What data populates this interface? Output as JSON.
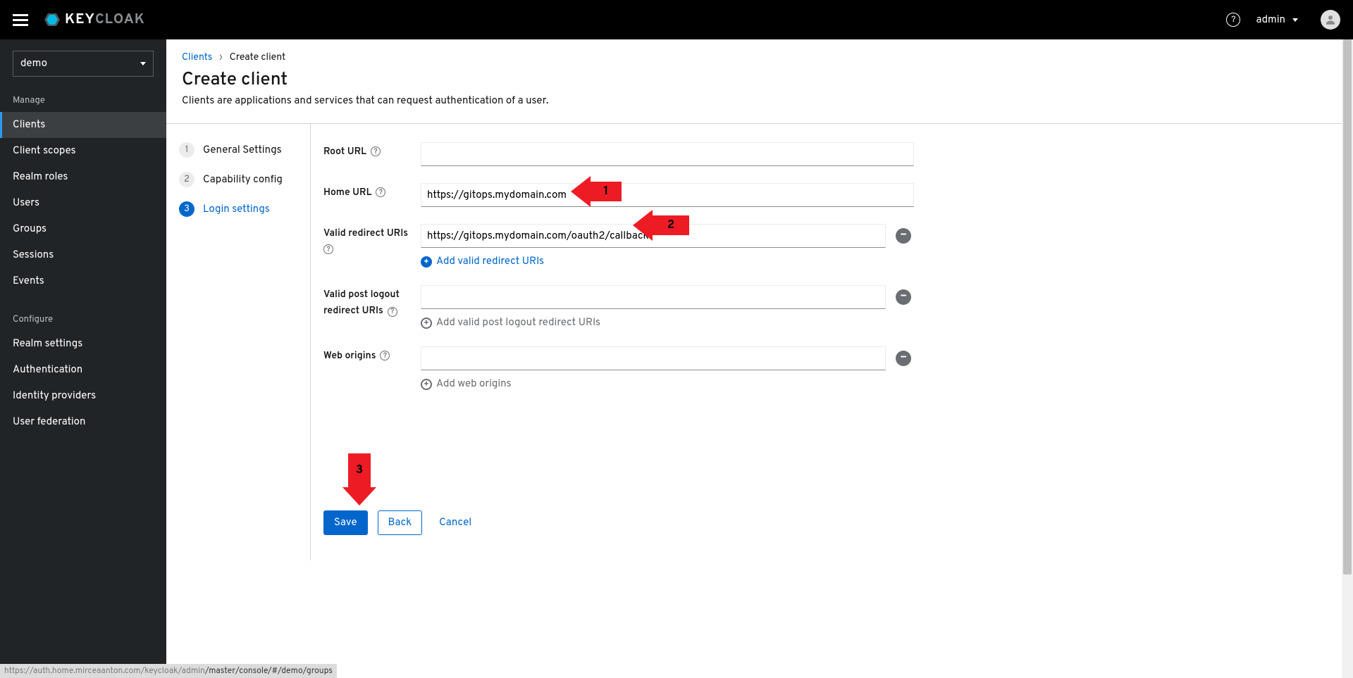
{
  "header": {
    "brand_prefix": "KEY",
    "brand_suffix": "CLOAK",
    "user": "admin"
  },
  "sidebar": {
    "realm": "demo",
    "manage_heading": "Manage",
    "configure_heading": "Configure",
    "manage_items": [
      "Clients",
      "Client scopes",
      "Realm roles",
      "Users",
      "Groups",
      "Sessions",
      "Events"
    ],
    "configure_items": [
      "Realm settings",
      "Authentication",
      "Identity providers",
      "User federation"
    ]
  },
  "breadcrumb": {
    "parent": "Clients",
    "current": "Create client"
  },
  "page": {
    "title": "Create client",
    "description": "Clients are applications and services that can request authentication of a user."
  },
  "wizard": {
    "steps": [
      {
        "num": "1",
        "label": "General Settings"
      },
      {
        "num": "2",
        "label": "Capability config"
      },
      {
        "num": "3",
        "label": "Login settings"
      }
    ],
    "active_index": 2
  },
  "form": {
    "root_url_label": "Root URL",
    "root_url_value": "",
    "home_url_label": "Home URL",
    "home_url_value": "https://gitops.mydomain.com",
    "valid_redirect_label": "Valid redirect URIs",
    "valid_redirect_value": "https://gitops.mydomain.com/oauth2/callback",
    "add_valid_redirect": "Add valid redirect URIs",
    "valid_post_logout_label_1": "Valid post logout",
    "valid_post_logout_label_2": "redirect URIs",
    "valid_post_logout_value": "",
    "add_valid_post_logout": "Add valid post logout redirect URIs",
    "web_origins_label": "Web origins",
    "web_origins_value": "",
    "add_web_origins": "Add web origins"
  },
  "actions": {
    "save": "Save",
    "back": "Back",
    "cancel": "Cancel"
  },
  "annotations": {
    "a1": "1",
    "a2": "2",
    "a3": "3"
  },
  "status_url": {
    "dim": "https://auth.home.mirceaanton.com/keycloak/admin",
    "bold": "/master/console/#/demo/groups"
  }
}
